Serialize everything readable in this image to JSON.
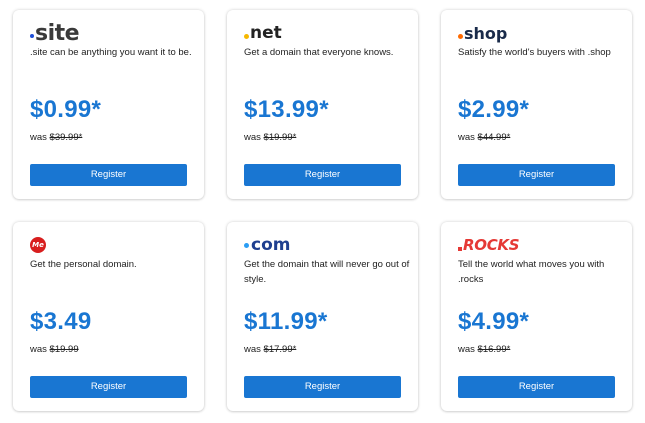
{
  "cards": [
    {
      "tld": ".site",
      "logo_text": "site",
      "description": ".site can be anything you want it to be.",
      "price": "$0.99*",
      "was_label": "was",
      "old_price": "$39.99*",
      "button_label": "Register",
      "logo_color": "#3a3a3a",
      "accent": "#1e4fd8"
    },
    {
      "tld": ".net",
      "logo_text": "net",
      "description": "Get a domain that everyone knows.",
      "price": "$13.99*",
      "was_label": "was",
      "old_price": "$19.99*",
      "button_label": "Register",
      "logo_color": "#222222",
      "accent": "#f6b800"
    },
    {
      "tld": ".shop",
      "logo_text": "shop",
      "description": "Satisfy the world's buyers with .shop",
      "price": "$2.99*",
      "was_label": "was",
      "old_price": "$44.99*",
      "button_label": "Register",
      "logo_color": "#1a2b4a",
      "accent": "#ff6a00"
    },
    {
      "tld": ".me",
      "logo_text": "Me",
      "description": "Get the personal domain.",
      "price": "$3.49",
      "was_label": "was",
      "old_price": "$19.99",
      "button_label": "Register",
      "logo_color": "#ffffff",
      "accent": "#d81e1e"
    },
    {
      "tld": ".com",
      "logo_text": "com",
      "description": "Get the domain that will never go out of style.",
      "price": "$11.99*",
      "was_label": "was",
      "old_price": "$17.99*",
      "button_label": "Register",
      "logo_color": "#1f3f8f",
      "accent": "#2a9df4"
    },
    {
      "tld": ".rocks",
      "logo_text": "ROCKS",
      "description": "Tell the world what moves you with .rocks",
      "price": "$4.99*",
      "was_label": "was",
      "old_price": "$16.99*",
      "button_label": "Register",
      "logo_color": "#e53935",
      "accent": "#e53935"
    }
  ],
  "colors": {
    "price": "#1976d2",
    "button_bg": "#1976d2",
    "button_text": "#ffffff"
  }
}
